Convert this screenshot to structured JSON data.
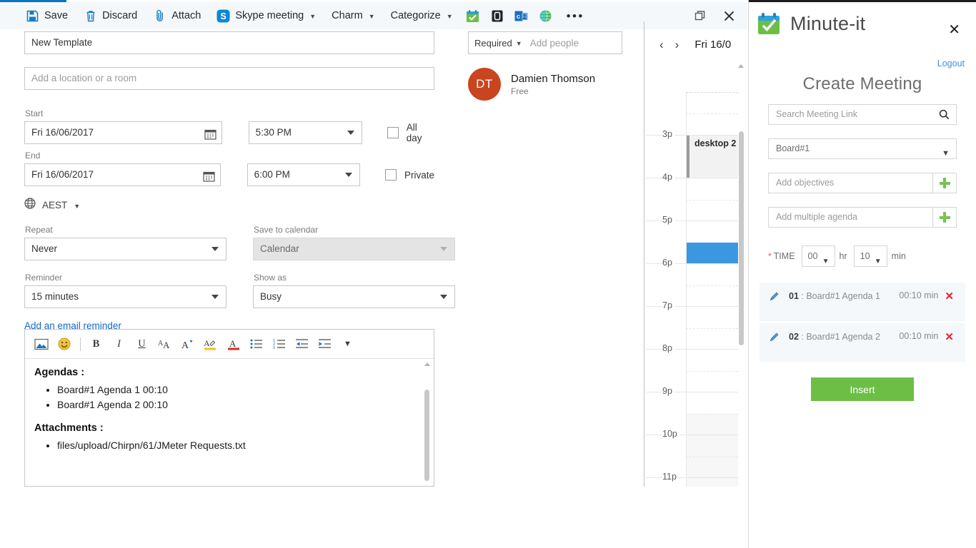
{
  "outlook": {
    "commands": [
      {
        "name": "save",
        "label": "Save",
        "icon": "save-icon"
      },
      {
        "name": "discard",
        "label": "Discard",
        "icon": "trash-icon"
      },
      {
        "name": "attach",
        "label": "Attach",
        "icon": "paperclip-icon"
      },
      {
        "name": "skype",
        "label": "Skype meeting",
        "icon": "skype-icon",
        "caret": true
      },
      {
        "name": "charm",
        "label": "Charm",
        "icon": "",
        "caret": true
      },
      {
        "name": "categorize",
        "label": "Categorize",
        "icon": "",
        "caret": true
      }
    ],
    "app_icons": [
      "minute-it-addin-icon",
      "boomerang-addin-icon",
      "outlook-addin-icon",
      "globe-addin-icon"
    ],
    "overflow_label": "•••",
    "window": {
      "restore": "restore-icon",
      "close": "close-icon"
    },
    "form": {
      "title_value": "New Template",
      "location_placeholder": "Add a location or a room",
      "start_label": "Start",
      "start_date": "Fri 16/06/2017",
      "start_time": "5:30 PM",
      "end_label": "End",
      "end_date": "Fri 16/06/2017",
      "end_time": "6:00 PM",
      "allday_label": "All day",
      "private_label": "Private",
      "timezone": "AEST",
      "repeat_label": "Repeat",
      "repeat_value": "Never",
      "save_to_calendar_label": "Save to calendar",
      "save_to_calendar_value": "Calendar",
      "reminder_label": "Reminder",
      "reminder_value": "15 minutes",
      "show_as_label": "Show as",
      "show_as_value": "Busy",
      "email_reminder_link": "Add an email reminder"
    },
    "editor": {
      "tools": [
        "insert-picture-icon",
        "emoji-icon",
        "bold-icon",
        "italic-icon",
        "underline-icon",
        "font-size-icon",
        "font-grow-icon",
        "highlight-icon",
        "font-color-icon",
        "bulleted-list-icon",
        "numbered-list-icon",
        "outdent-icon",
        "indent-icon",
        "more-formatting-icon"
      ],
      "agendas_heading": "Agendas :",
      "agenda_items": [
        "Board#1 Agenda 1 00:10",
        "Board#1 Agenda 2 00:10"
      ],
      "attachments_heading": "Attachments :",
      "attachment_items": [
        "files/upload/Chirpn/61/JMeter Requests.txt"
      ]
    },
    "attendees": {
      "required_label": "Required",
      "add_people_placeholder": "Add people",
      "people": [
        {
          "initials": "DT",
          "name": "Damien Thomson",
          "status": "Free",
          "color": "#c8451f"
        }
      ]
    },
    "calendar": {
      "prev": "‹",
      "next": "›",
      "date_label": "Fri 16/0",
      "hours": [
        "3p",
        "4p",
        "5p",
        "6p",
        "7p",
        "8p",
        "9p",
        "10p",
        "11p"
      ],
      "events": [
        {
          "title": "desktop 2",
          "hour": "3p",
          "color": "#f2f2f2"
        },
        {
          "title": "",
          "hour": "5p",
          "color": "#3b97e0"
        }
      ]
    }
  },
  "minute_it": {
    "app_title": "Minute-it",
    "logo_icon": "minute-it-logo-icon",
    "close_icon": "close-icon",
    "logout_label": "Logout",
    "section_title": "Create Meeting",
    "search_placeholder": "Search Meeting Link",
    "search_icon": "search-icon",
    "board_value": "Board#1",
    "objectives_placeholder": "Add objectives",
    "agenda_placeholder": "Add multiple agenda",
    "add_icon": "plus-icon",
    "time_required_mark": "*",
    "time_label": "TIME",
    "time_hours": "00",
    "hr_unit": "hr",
    "time_minutes": "10",
    "min_unit": "min",
    "agenda_rows": [
      {
        "index": "01",
        "sep": " : ",
        "title": "Board#1 Agenda 1",
        "duration": "00:10 min",
        "edit_icon": "pencil-icon",
        "delete_icon": "delete-icon"
      },
      {
        "index": "02",
        "sep": " : ",
        "title": "Board#1 Agenda 2",
        "duration": "00:10 min",
        "edit_icon": "pencil-icon",
        "delete_icon": "delete-icon"
      }
    ],
    "insert_label": "Insert",
    "colors": {
      "accent_green": "#6dbe45",
      "link_blue": "#3f8fd8",
      "delete_red": "#e8212a"
    }
  }
}
